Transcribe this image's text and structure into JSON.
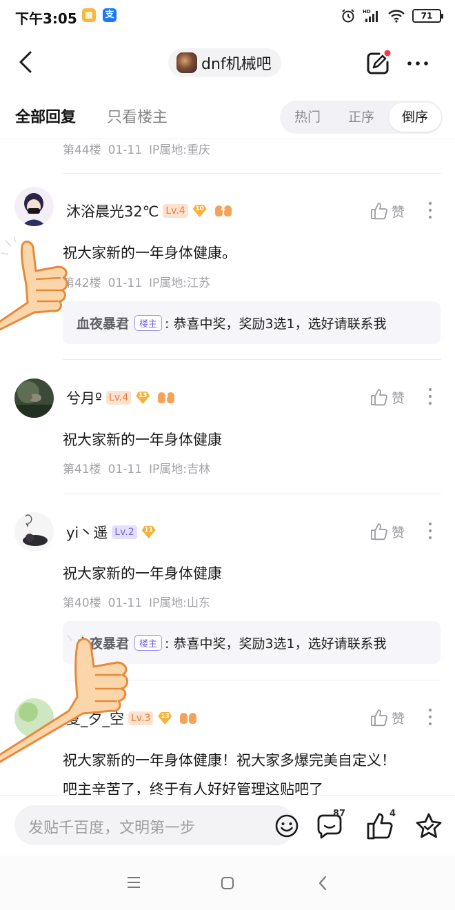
{
  "status_bar": {
    "time": "下午3:05",
    "app2_label": "支",
    "battery": "71"
  },
  "header": {
    "forum_name": "dnf机械吧"
  },
  "sort_bar": {
    "tab_all": "全部回复",
    "tab_owner_only": "只看楼主",
    "options": [
      "热门",
      "正序",
      "倒序"
    ],
    "selected": "倒序"
  },
  "top_partial": {
    "floor": "第44楼",
    "date": "01-11",
    "ip": "IP属地:重庆"
  },
  "posts": [
    {
      "user": "沐浴晨光32℃",
      "level": "Lv.4",
      "gem": "10",
      "lung": "4",
      "content": "祝大家新的一年身体健康。",
      "floor": "第42楼",
      "date": "01-11",
      "ip": "IP属地:江苏",
      "like_label": "赞",
      "reply": {
        "name": "血夜暴君",
        "tag": "楼主",
        "text": ": 恭喜中奖，奖励3选1，选好请联系我"
      }
    },
    {
      "user": "兮月º",
      "level": "Lv.4",
      "gem": "13",
      "lung": "3",
      "content": "祝大家新的一年身体健康",
      "floor": "第41楼",
      "date": "01-11",
      "ip": "IP属地:吉林",
      "like_label": "赞"
    },
    {
      "user": "yi丶遥",
      "level": "Lv.2",
      "gem": "11",
      "content": "祝大家新的一年身体健康",
      "floor": "第40楼",
      "date": "01-11",
      "ip": "IP属地:山东",
      "like_label": "赞",
      "reply": {
        "name": "血夜暴君",
        "tag": "楼主",
        "text": ": 恭喜中奖，奖励3选1，选好请联系我"
      }
    },
    {
      "user": "夏_夕_空",
      "level": "Lv.3",
      "gem": "13",
      "content_line1": "祝大家新的一年身体健康！祝大家多爆完美自定义！",
      "content_line2": "吧主辛苦了，终于有人好好管理这贴吧了",
      "like_label": "赞"
    }
  ],
  "bottom_bar": {
    "placeholder": "发贴千百度，文明第一步",
    "comment_count": "87",
    "like_count": "4"
  },
  "icons": {
    "back": "back-arrow-icon",
    "edit": "edit-icon",
    "more": "more-icon",
    "emoji": "emoji-icon",
    "comment": "comment-icon",
    "thumb": "thumb-up-icon",
    "star": "star-icon"
  },
  "colors": {
    "level_orange": "#e47c3d",
    "level_purple": "#7462e4",
    "badge_red": "#f2384a"
  }
}
